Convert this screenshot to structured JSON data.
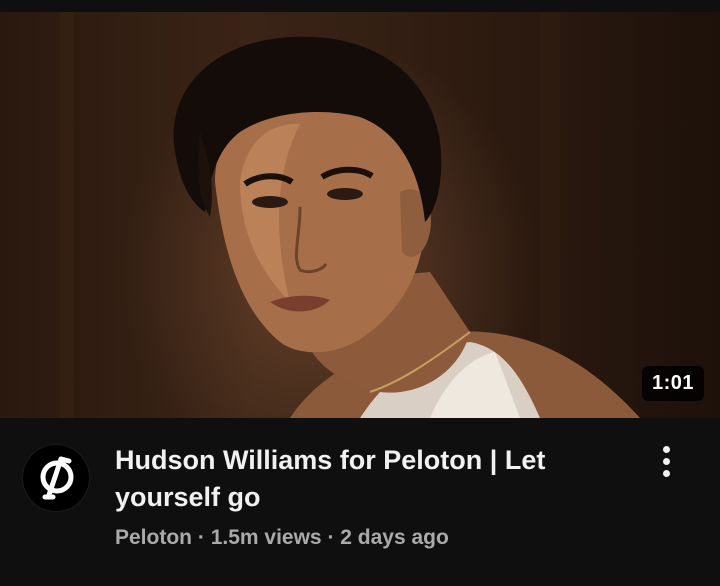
{
  "video": {
    "duration": "1:01",
    "title": "Hudson Williams for Peloton | Let yourself go",
    "channel": "Peloton",
    "separator": "·",
    "views": "1.5m views",
    "age": "2 days ago"
  },
  "icons": {
    "avatar": "peloton-logo-icon",
    "menu": "more-vertical-icon"
  },
  "colors": {
    "background": "#0f0f0f",
    "title": "#f1f1f1",
    "meta": "#aaaaaa",
    "badge": "#000000"
  }
}
